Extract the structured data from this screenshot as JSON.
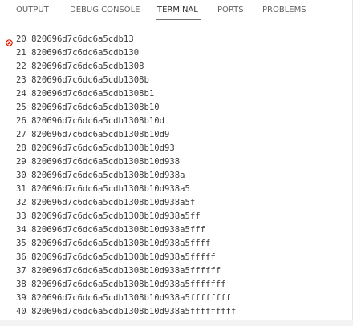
{
  "tabs": {
    "output": "OUTPUT",
    "debug_console": "DEBUG CONSOLE",
    "terminal": "TERMINAL",
    "ports": "PORTS",
    "problems": "PROBLEMS",
    "active": "TERMINAL"
  },
  "colors": {
    "error": "#e51400",
    "active_underline": "#6f6f6f",
    "text": "#3b3b3b"
  },
  "terminal": {
    "lines": [
      "20 820696d7c6dc6a5cdb13",
      "21 820696d7c6dc6a5cdb130",
      "22 820696d7c6dc6a5cdb1308",
      "23 820696d7c6dc6a5cdb1308b",
      "24 820696d7c6dc6a5cdb1308b1",
      "25 820696d7c6dc6a5cdb1308b10",
      "26 820696d7c6dc6a5cdb1308b10d",
      "27 820696d7c6dc6a5cdb1308b10d9",
      "28 820696d7c6dc6a5cdb1308b10d93",
      "29 820696d7c6dc6a5cdb1308b10d938",
      "30 820696d7c6dc6a5cdb1308b10d938a",
      "31 820696d7c6dc6a5cdb1308b10d938a5",
      "32 820696d7c6dc6a5cdb1308b10d938a5f",
      "33 820696d7c6dc6a5cdb1308b10d938a5ff",
      "34 820696d7c6dc6a5cdb1308b10d938a5fff",
      "35 820696d7c6dc6a5cdb1308b10d938a5ffff",
      "36 820696d7c6dc6a5cdb1308b10d938a5fffff",
      "37 820696d7c6dc6a5cdb1308b10d938a5ffffff",
      "38 820696d7c6dc6a5cdb1308b10d938a5fffffff",
      "39 820696d7c6dc6a5cdb1308b10d938a5ffffffff",
      "40 820696d7c6dc6a5cdb1308b10d938a5fffffffff"
    ],
    "error_marker_icon": "error-circle-icon"
  }
}
